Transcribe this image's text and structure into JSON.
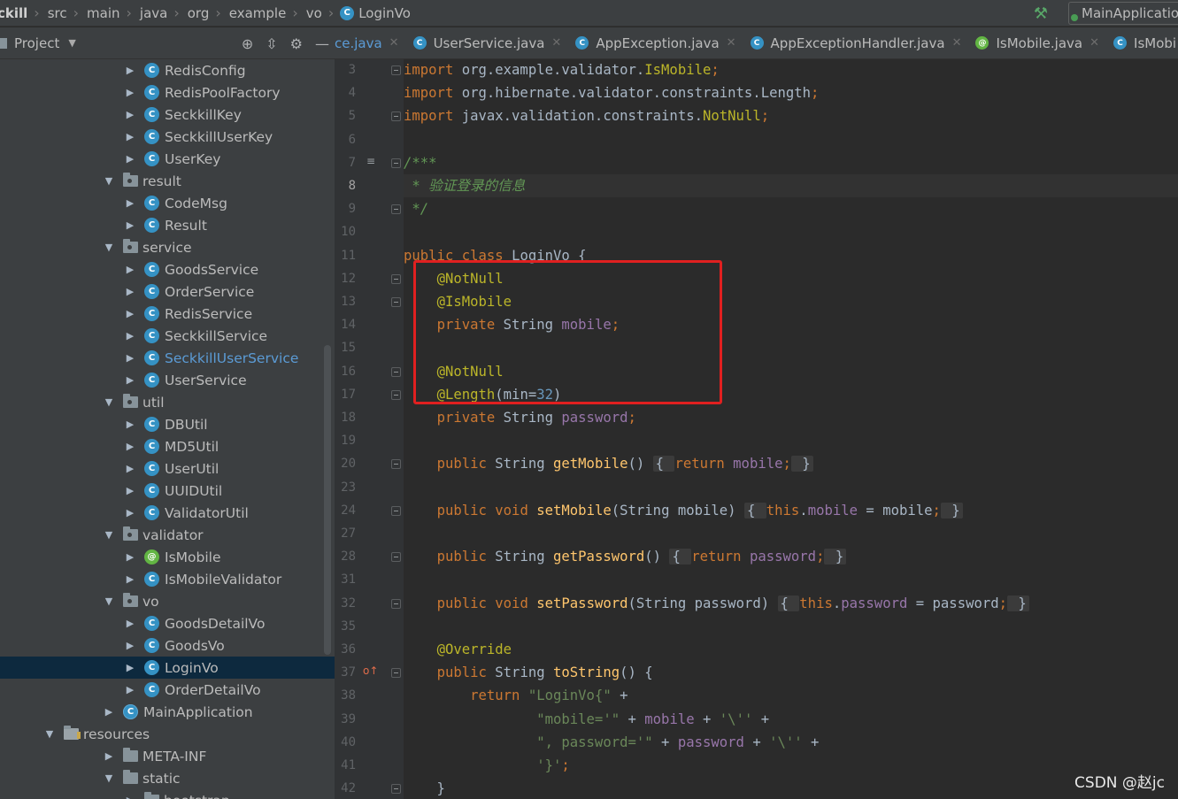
{
  "breadcrumb": {
    "items": [
      "ckill",
      "src",
      "main",
      "java",
      "org",
      "example",
      "vo"
    ],
    "current_file": "LoginVo",
    "run_config": "MainApplication"
  },
  "project_panel": {
    "title": "Project",
    "tree": [
      {
        "label": "RedisConfig",
        "type": "class",
        "depth": 3,
        "expanded": false
      },
      {
        "label": "RedisPoolFactory",
        "type": "class",
        "depth": 3,
        "expanded": false
      },
      {
        "label": "SeckkillKey",
        "type": "class",
        "depth": 3,
        "expanded": false
      },
      {
        "label": "SeckkillUserKey",
        "type": "class",
        "depth": 3,
        "expanded": false
      },
      {
        "label": "UserKey",
        "type": "class",
        "depth": 3,
        "expanded": false
      },
      {
        "label": "result",
        "type": "package",
        "depth": 2,
        "expanded": true
      },
      {
        "label": "CodeMsg",
        "type": "class",
        "depth": 3,
        "expanded": false
      },
      {
        "label": "Result",
        "type": "class",
        "depth": 3,
        "expanded": false
      },
      {
        "label": "service",
        "type": "package",
        "depth": 2,
        "expanded": true
      },
      {
        "label": "GoodsService",
        "type": "class",
        "depth": 3,
        "expanded": false
      },
      {
        "label": "OrderService",
        "type": "class",
        "depth": 3,
        "expanded": false
      },
      {
        "label": "RedisService",
        "type": "class",
        "depth": 3,
        "expanded": false
      },
      {
        "label": "SeckkillService",
        "type": "class",
        "depth": 3,
        "expanded": false
      },
      {
        "label": "SeckkillUserService",
        "type": "class",
        "depth": 3,
        "expanded": false,
        "link": true
      },
      {
        "label": "UserService",
        "type": "class",
        "depth": 3,
        "expanded": false
      },
      {
        "label": "util",
        "type": "package",
        "depth": 2,
        "expanded": true
      },
      {
        "label": "DBUtil",
        "type": "class",
        "depth": 3,
        "expanded": false
      },
      {
        "label": "MD5Util",
        "type": "class",
        "depth": 3,
        "expanded": false
      },
      {
        "label": "UserUtil",
        "type": "class",
        "depth": 3,
        "expanded": false
      },
      {
        "label": "UUIDUtil",
        "type": "class",
        "depth": 3,
        "expanded": false
      },
      {
        "label": "ValidatorUtil",
        "type": "class",
        "depth": 3,
        "expanded": false
      },
      {
        "label": "validator",
        "type": "package",
        "depth": 2,
        "expanded": true
      },
      {
        "label": "IsMobile",
        "type": "annotation",
        "depth": 3,
        "expanded": false
      },
      {
        "label": "IsMobileValidator",
        "type": "class",
        "depth": 3,
        "expanded": false
      },
      {
        "label": "vo",
        "type": "package",
        "depth": 2,
        "expanded": true
      },
      {
        "label": "GoodsDetailVo",
        "type": "class",
        "depth": 3,
        "expanded": false
      },
      {
        "label": "GoodsVo",
        "type": "class",
        "depth": 3,
        "expanded": false
      },
      {
        "label": "LoginVo",
        "type": "class",
        "depth": 3,
        "expanded": false,
        "selected": true
      },
      {
        "label": "OrderDetailVo",
        "type": "class",
        "depth": 3,
        "expanded": false
      },
      {
        "label": "MainApplication",
        "type": "app",
        "depth": 2,
        "expanded": false
      },
      {
        "label": "resources",
        "type": "resources",
        "depth": 1,
        "expanded": true
      },
      {
        "label": "META-INF",
        "type": "folder",
        "depth": 2,
        "expanded": false
      },
      {
        "label": "static",
        "type": "folder",
        "depth": 2,
        "expanded": true
      },
      {
        "label": "bootstrap",
        "type": "folder",
        "depth": 3,
        "expanded": false
      }
    ]
  },
  "tabs": [
    {
      "label": "ce.java",
      "icon": "class"
    },
    {
      "label": "UserService.java",
      "icon": "class"
    },
    {
      "label": "AppException.java",
      "icon": "class"
    },
    {
      "label": "AppExceptionHandler.java",
      "icon": "class"
    },
    {
      "label": "IsMobile.java",
      "icon": "annotation"
    },
    {
      "label": "IsMobi",
      "icon": "class"
    }
  ],
  "editor": {
    "current_line": "8",
    "lines": [
      {
        "n": "3",
        "tokens": [
          [
            "kw",
            "import "
          ],
          [
            "",
            "org.example.validator."
          ],
          [
            "anno",
            "IsMobile"
          ],
          [
            "kw",
            ";"
          ]
        ]
      },
      {
        "n": "4",
        "tokens": [
          [
            "kw",
            "import "
          ],
          [
            "",
            "org.hibernate.validator.constraints.Length"
          ],
          [
            "kw",
            ";"
          ]
        ]
      },
      {
        "n": "5",
        "tokens": [
          [
            "kw",
            "import "
          ],
          [
            "",
            "javax.validation.constraints."
          ],
          [
            "anno",
            "NotNull"
          ],
          [
            "kw",
            ";"
          ]
        ]
      },
      {
        "n": "6",
        "tokens": []
      },
      {
        "n": "7",
        "tokens": [
          [
            "cmt",
            "/***"
          ]
        ]
      },
      {
        "n": "8",
        "tokens": [
          [
            "cmt",
            " * 验证登录的信息"
          ]
        ]
      },
      {
        "n": "9",
        "tokens": [
          [
            "cmt",
            " */"
          ]
        ]
      },
      {
        "n": "10",
        "tokens": []
      },
      {
        "n": "11",
        "tokens": [
          [
            "kw",
            "public class "
          ],
          [
            "",
            "LoginVo {"
          ]
        ]
      },
      {
        "n": "12",
        "tokens": [
          [
            "",
            "    "
          ],
          [
            "anno",
            "@NotNull"
          ]
        ]
      },
      {
        "n": "13",
        "tokens": [
          [
            "",
            "    "
          ],
          [
            "anno",
            "@IsMobile"
          ]
        ]
      },
      {
        "n": "14",
        "tokens": [
          [
            "",
            "    "
          ],
          [
            "kw",
            "private "
          ],
          [
            "",
            "String "
          ],
          [
            "fld",
            "mobile"
          ],
          [
            "kw",
            ";"
          ]
        ]
      },
      {
        "n": "15",
        "tokens": []
      },
      {
        "n": "16",
        "tokens": [
          [
            "",
            "    "
          ],
          [
            "anno",
            "@NotNull"
          ]
        ]
      },
      {
        "n": "17",
        "tokens": [
          [
            "",
            "    "
          ],
          [
            "anno",
            "@Length"
          ],
          [
            "",
            "(min="
          ],
          [
            "num",
            "32"
          ],
          [
            "",
            ")"
          ]
        ]
      },
      {
        "n": "18",
        "tokens": [
          [
            "",
            "    "
          ],
          [
            "kw",
            "private "
          ],
          [
            "",
            "String "
          ],
          [
            "fld",
            "password"
          ],
          [
            "kw",
            ";"
          ]
        ]
      },
      {
        "n": "19",
        "tokens": []
      },
      {
        "n": "20",
        "tokens": [
          [
            "",
            "    "
          ],
          [
            "kw",
            "public "
          ],
          [
            "",
            "String "
          ],
          [
            "mth",
            "getMobile"
          ],
          [
            "",
            "() "
          ],
          [
            "col",
            "{ "
          ],
          [
            "kw",
            "return "
          ],
          [
            "fld",
            "mobile"
          ],
          [
            "kw",
            ";"
          ],
          [
            "col",
            " }"
          ]
        ]
      },
      {
        "n": "23",
        "tokens": []
      },
      {
        "n": "24",
        "tokens": [
          [
            "",
            "    "
          ],
          [
            "kw",
            "public void "
          ],
          [
            "mth",
            "setMobile"
          ],
          [
            "",
            "(String mobile) "
          ],
          [
            "col",
            "{ "
          ],
          [
            "kw",
            "this"
          ],
          [
            "",
            "."
          ],
          [
            "fld",
            "mobile"
          ],
          [
            "",
            " = mobile"
          ],
          [
            "kw",
            ";"
          ],
          [
            "col",
            " }"
          ]
        ]
      },
      {
        "n": "27",
        "tokens": []
      },
      {
        "n": "28",
        "tokens": [
          [
            "",
            "    "
          ],
          [
            "kw",
            "public "
          ],
          [
            "",
            "String "
          ],
          [
            "mth",
            "getPassword"
          ],
          [
            "",
            "() "
          ],
          [
            "col",
            "{ "
          ],
          [
            "kw",
            "return "
          ],
          [
            "fld",
            "password"
          ],
          [
            "kw",
            ";"
          ],
          [
            "col",
            " }"
          ]
        ]
      },
      {
        "n": "31",
        "tokens": []
      },
      {
        "n": "32",
        "tokens": [
          [
            "",
            "    "
          ],
          [
            "kw",
            "public void "
          ],
          [
            "mth",
            "setPassword"
          ],
          [
            "",
            "(String password) "
          ],
          [
            "col",
            "{ "
          ],
          [
            "kw",
            "this"
          ],
          [
            "",
            "."
          ],
          [
            "fld",
            "password"
          ],
          [
            "",
            " = password"
          ],
          [
            "kw",
            ";"
          ],
          [
            "col",
            " }"
          ]
        ]
      },
      {
        "n": "35",
        "tokens": []
      },
      {
        "n": "36",
        "tokens": [
          [
            "",
            "    "
          ],
          [
            "anno",
            "@Override"
          ]
        ]
      },
      {
        "n": "37",
        "tokens": [
          [
            "",
            "    "
          ],
          [
            "kw",
            "public "
          ],
          [
            "",
            "String "
          ],
          [
            "mth",
            "toString"
          ],
          [
            "",
            "() {"
          ]
        ]
      },
      {
        "n": "38",
        "tokens": [
          [
            "",
            "        "
          ],
          [
            "kw",
            "return "
          ],
          [
            "str",
            "\"LoginVo{\""
          ],
          [
            "",
            " +"
          ]
        ]
      },
      {
        "n": "39",
        "tokens": [
          [
            "",
            "                "
          ],
          [
            "str",
            "\"mobile='\""
          ],
          [
            "",
            " + "
          ],
          [
            "fld",
            "mobile"
          ],
          [
            "",
            " + "
          ],
          [
            "str",
            "'\\''"
          ],
          [
            "",
            " +"
          ]
        ]
      },
      {
        "n": "40",
        "tokens": [
          [
            "",
            "                "
          ],
          [
            "str",
            "\", password='\""
          ],
          [
            "",
            " + "
          ],
          [
            "fld",
            "password"
          ],
          [
            "",
            " + "
          ],
          [
            "str",
            "'\\''"
          ],
          [
            "",
            " +"
          ]
        ]
      },
      {
        "n": "41",
        "tokens": [
          [
            "",
            "                "
          ],
          [
            "str",
            "'}'"
          ],
          [
            "kw",
            ";"
          ]
        ]
      },
      {
        "n": "42",
        "tokens": [
          [
            "",
            "    }"
          ]
        ]
      }
    ]
  },
  "watermark": "CSDN @赵jc",
  "colors": {
    "highlight_box": "#e02020",
    "keyword": "#cc7832",
    "annotation": "#bbb529",
    "field": "#9876aa",
    "string": "#6a8759",
    "comment": "#629755"
  }
}
